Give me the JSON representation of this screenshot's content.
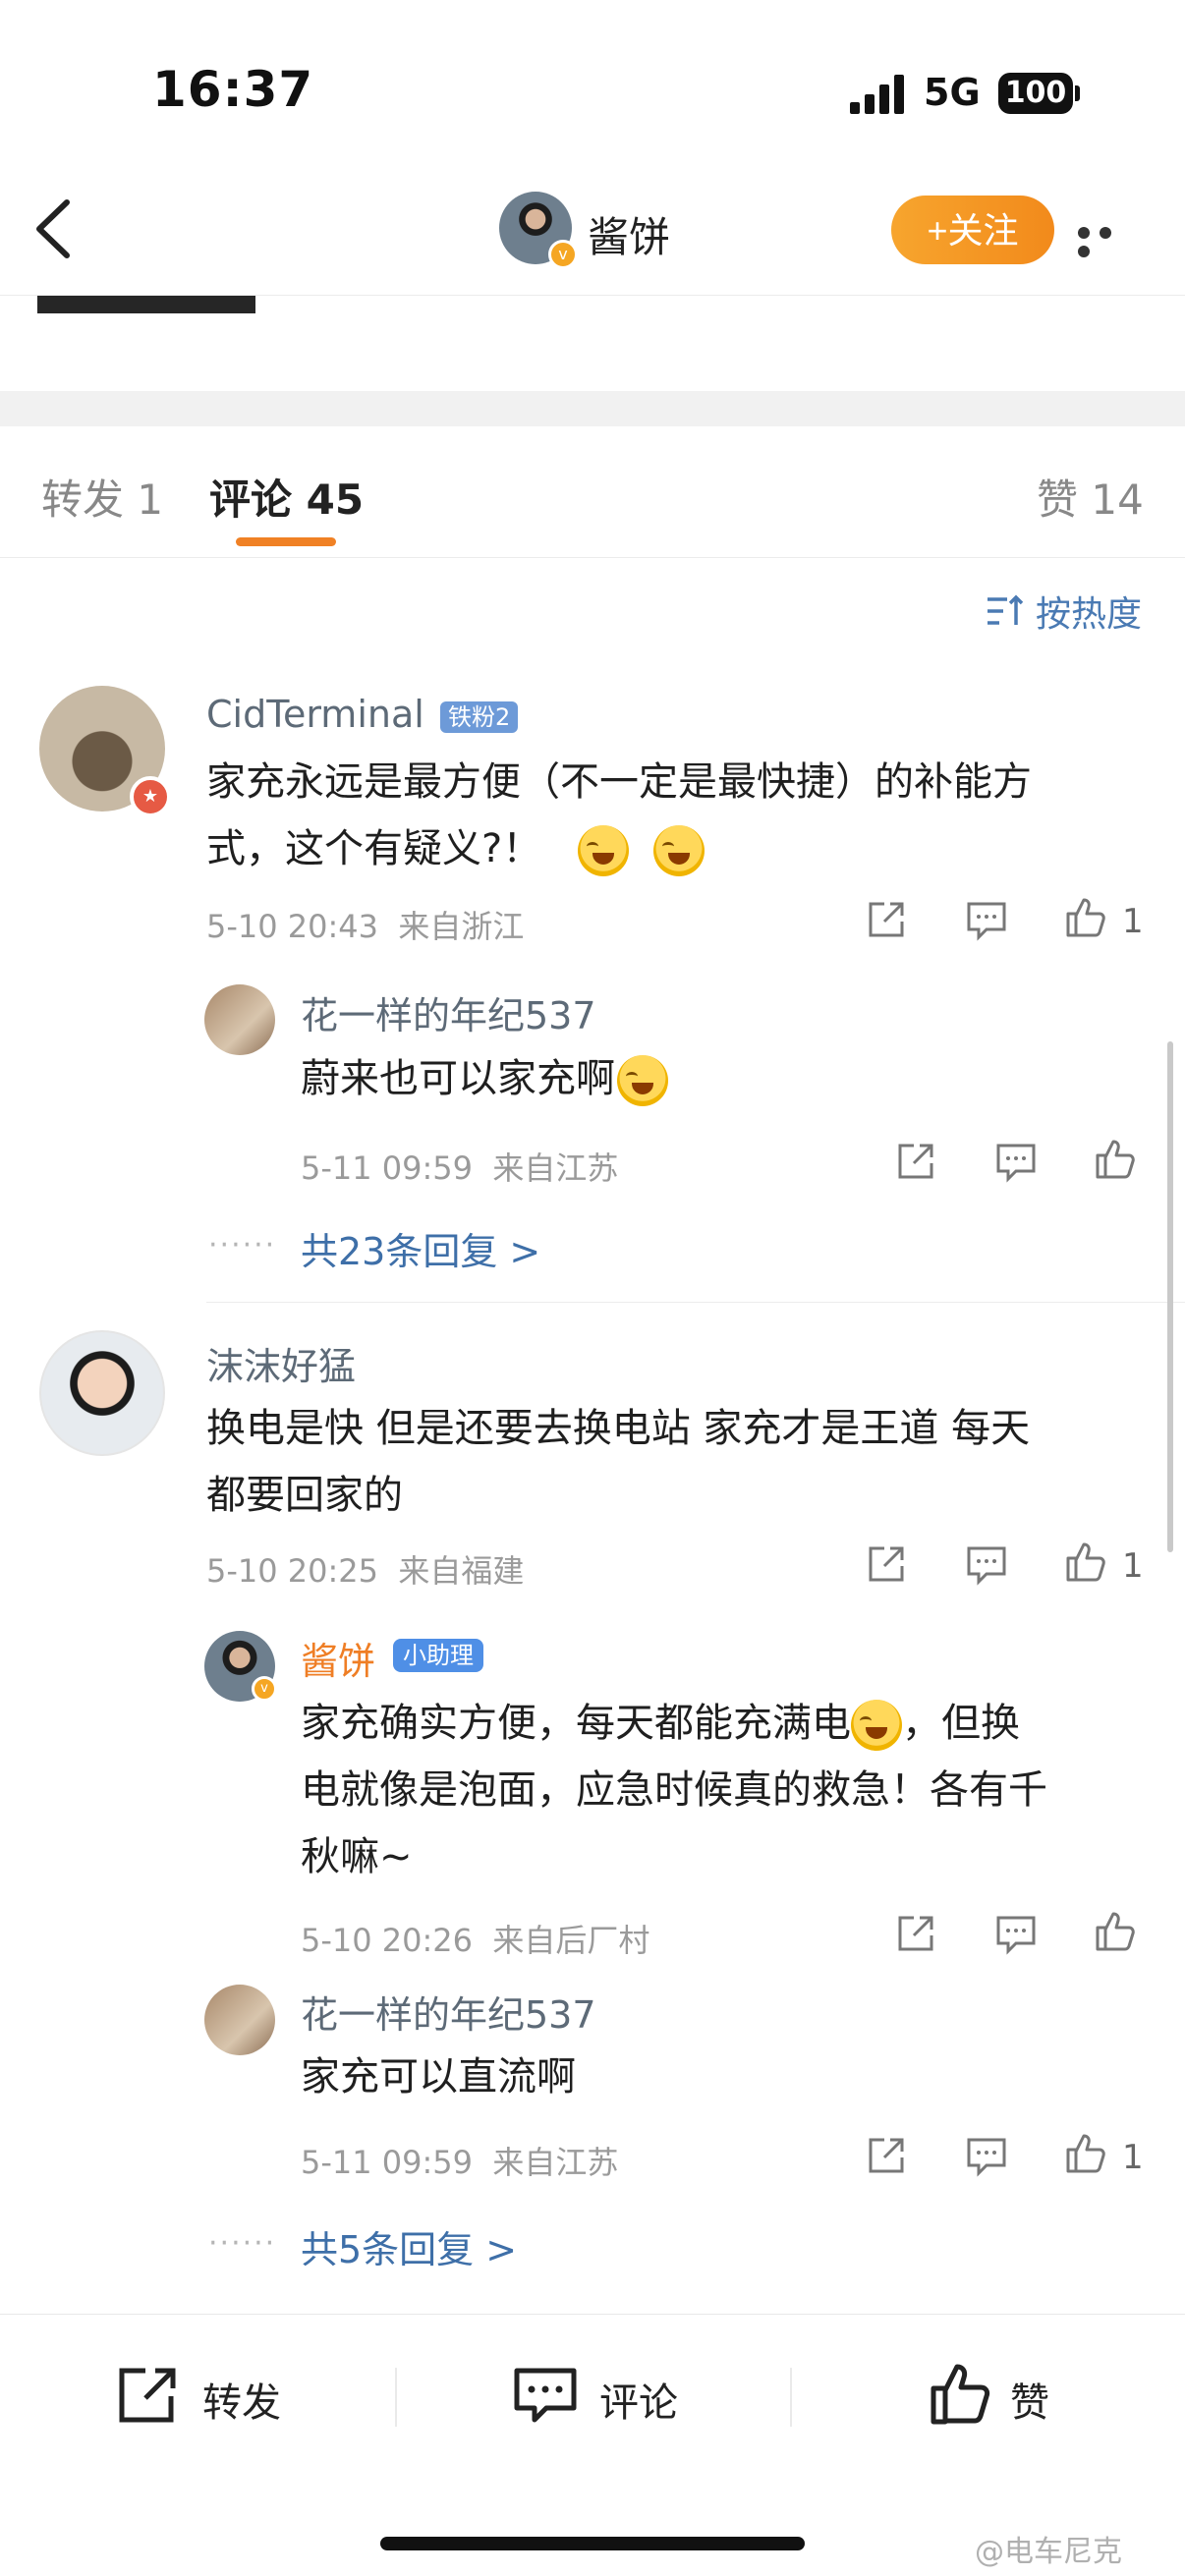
{
  "status_bar": {
    "time": "16:37",
    "network": "5G",
    "battery": "100"
  },
  "nav": {
    "user_name": "酱饼",
    "follow_label": "+关注"
  },
  "tabs": [
    {
      "label": "转发",
      "count": "1"
    },
    {
      "label": "评论",
      "count": "45"
    },
    {
      "label": "赞",
      "count": "14"
    }
  ],
  "sort_label": "按热度",
  "comments": [
    {
      "name": "CidTerminal",
      "badge": "铁粉2",
      "text_line1": "家充永远是最方便（不一定是最快捷）的补能方",
      "text_line2": "式，这个有疑义?！",
      "date": "5-10 20:43",
      "location": "来自浙江",
      "likes": "1",
      "replies": [
        {
          "name": "花一样的年纪537",
          "text": "蔚来也可以家充啊",
          "date": "5-11 09:59",
          "location": "来自江苏",
          "likes": ""
        }
      ],
      "more_replies": "共23条回复 >"
    },
    {
      "name": "沫沫好猛",
      "text_line1": "换电是快 但是还要去换电站  家充才是王道 每天",
      "text_line2": "都要回家的",
      "date": "5-10 20:25",
      "location": "来自福建",
      "likes": "1",
      "replies": [
        {
          "name": "酱饼",
          "badge": "小助理",
          "text_line1": "家充确实方便，每天都能充满电",
          "text_line1b": "，但换",
          "text_line2": "电就像是泡面，应急时候真的救急！各有千",
          "text_line3": "秋嘛~",
          "date": "5-10 20:26",
          "location": "来自后厂村",
          "likes": ""
        },
        {
          "name": "花一样的年纪537",
          "text": "家充可以直流啊",
          "date": "5-11 09:59",
          "location": "来自江苏",
          "likes": "1"
        }
      ],
      "more_replies": "共5条回复 >"
    }
  ],
  "bottom_bar": {
    "repost": "转发",
    "comment": "评论",
    "like": "赞"
  },
  "watermark": "@电车尼克",
  "colors": {
    "accent_orange": "#f08125",
    "link_blue": "#3e6fa8",
    "follow_btn": "#f39a27"
  }
}
